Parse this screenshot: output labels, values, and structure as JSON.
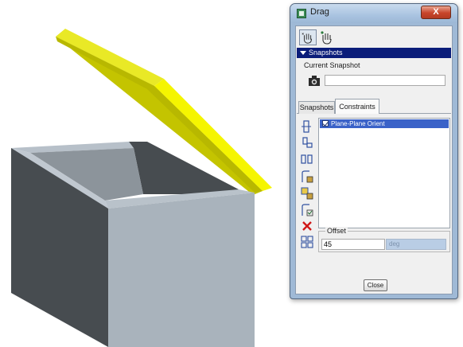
{
  "dialog": {
    "title": "Drag",
    "close_glyph": "X",
    "title_icon": "dialog-icon",
    "toolbar": [
      {
        "icon": "drag-hand-free-icon"
      },
      {
        "icon": "drag-hand-point-icon"
      }
    ],
    "snapshots_section": {
      "header": "Snapshots",
      "current_snapshot_label": "Current Snapshot",
      "snapshot_name_value": "",
      "camera_icon": "camera-icon"
    },
    "tabs": [
      {
        "label": "Snapshots",
        "active": false
      },
      {
        "label": "Constraints",
        "active": true
      }
    ],
    "constraint_tools": [
      "align-icon",
      "mate-icon",
      "parallel-icon",
      "motion-axis-icon",
      "body-lock-icon",
      "body-unlock-icon",
      "delete-constraint-icon",
      "assemble-icon"
    ],
    "constraints": [
      {
        "label": "Plane-Plane Orient",
        "checked": true,
        "selected": true
      }
    ],
    "offset": {
      "label": "Offset",
      "value": "45",
      "unit": "deg"
    },
    "close_label": "Close"
  },
  "colors": {
    "lid_yellow": "#f5f500",
    "box_gray": "#a9b3bc",
    "selection_blue": "#3a62c8",
    "section_header": "#0b1d7a"
  }
}
